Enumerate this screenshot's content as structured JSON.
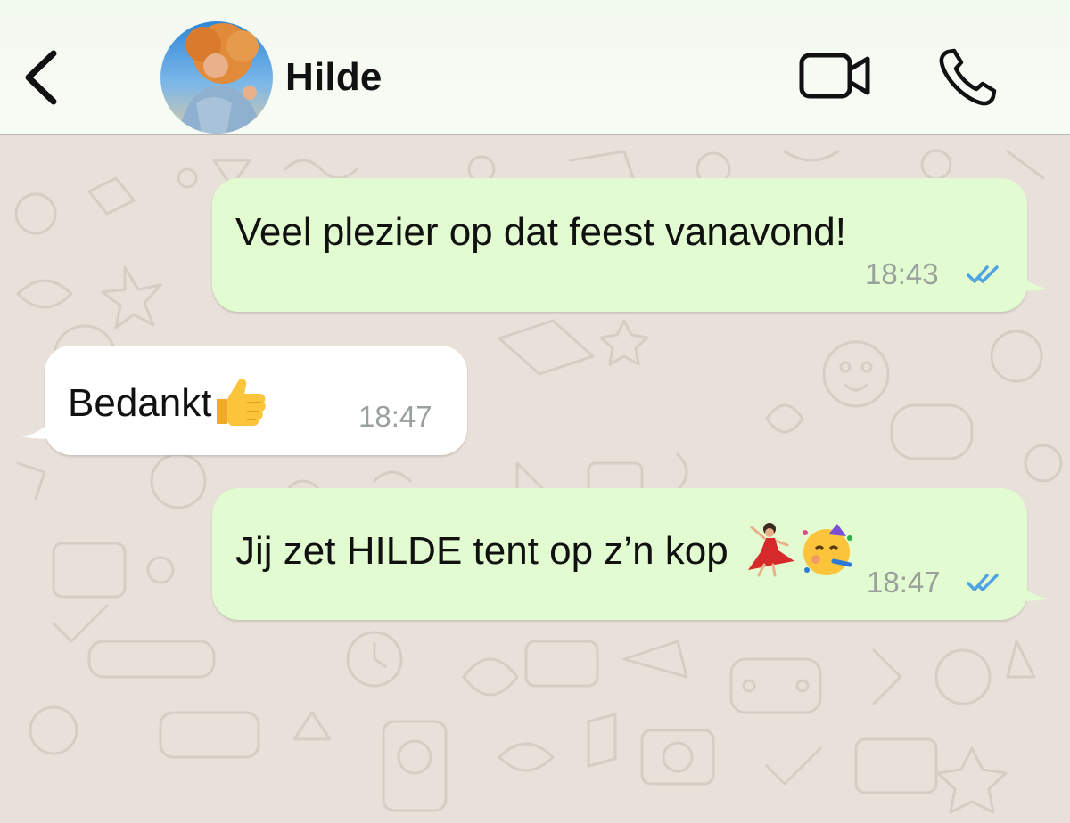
{
  "header": {
    "back_icon": "chevron-left-icon",
    "contact_name": "Hilde",
    "video_icon": "video-camera-icon",
    "call_icon": "phone-icon"
  },
  "messages": [
    {
      "direction": "outgoing",
      "text": "Veel plezier op dat feest vanavond!",
      "time": "18:43",
      "status": "read"
    },
    {
      "direction": "incoming",
      "text": "Bedankt",
      "emoji": [
        "thumbs-up"
      ],
      "time": "18:47"
    },
    {
      "direction": "outgoing",
      "text": "Jij zet HILDE tent op z’n kop",
      "emoji": [
        "woman-dancing",
        "partying-face"
      ],
      "time": "18:47",
      "status": "read"
    }
  ],
  "colors": {
    "outgoing_bubble": "#e2fbd0",
    "incoming_bubble": "#ffffff",
    "read_ticks": "#4fa3e0",
    "wallpaper": "#e8e1d9"
  }
}
